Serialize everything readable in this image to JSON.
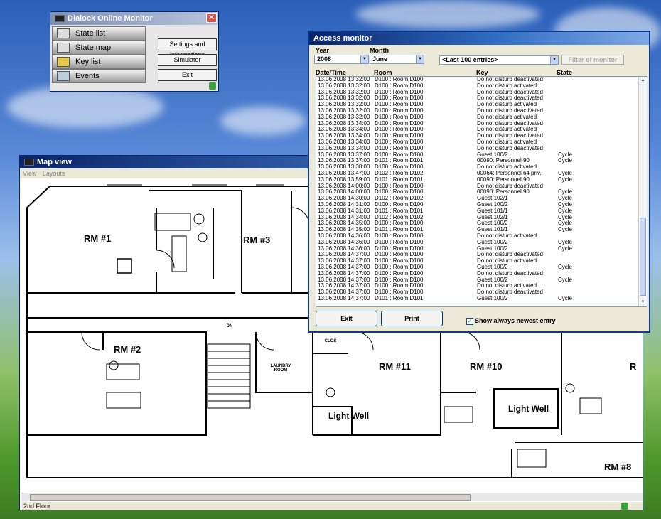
{
  "dialock": {
    "title": "Dialock Online Monitor",
    "nav": [
      {
        "label": "State list",
        "icon": "state-list-icon"
      },
      {
        "label": "State map",
        "icon": "state-map-icon"
      },
      {
        "label": "Key list",
        "icon": "key-list-icon"
      },
      {
        "label": "Events",
        "icon": "events-icon"
      }
    ],
    "buttons": {
      "settings": "Settings and informations",
      "simulator": "Simulator",
      "exit": "Exit"
    },
    "close": "✕"
  },
  "mapview": {
    "title": "Map view",
    "menu": [
      "View",
      "Layouts"
    ],
    "status": "2nd Floor",
    "rooms": [
      "RM #1",
      "RM #3",
      "RM #2",
      "RM #11",
      "RM #10",
      "R",
      "RM #8"
    ],
    "labels": {
      "laundry": "LAUNDRY ROOM",
      "clos": "CLOS",
      "light_well_1": "Light Well",
      "light_well_2": "Light Well",
      "dn": "DN"
    }
  },
  "access": {
    "title": "Access monitor",
    "year_label": "Year",
    "month_label": "Month",
    "year": "2008",
    "month": "June",
    "entries_filter": "<Last 100 entries>",
    "filter_button": "Filter of monitor",
    "columns": [
      "Date/Time",
      "Room",
      "Key",
      "State"
    ],
    "rows": [
      [
        "13.06.2008 13:32:00",
        "D100 : Room D100",
        "Do not disturb deactivated",
        ""
      ],
      [
        "13.06.2008 13:32:00",
        "D100 : Room D100",
        "Do not disturb activated",
        ""
      ],
      [
        "13.06.2008 13:32:00",
        "D100 : Room D100",
        "Do not disturb deactivated",
        ""
      ],
      [
        "13.06.2008 13:32:00",
        "D100 : Room D100",
        "Do not disturb deactivated",
        ""
      ],
      [
        "13.06.2008 13:32:00",
        "D100 : Room D100",
        "Do not disturb activated",
        ""
      ],
      [
        "13.06.2008 13:32:00",
        "D100 : Room D100",
        "Do not disturb deactivated",
        ""
      ],
      [
        "13.06.2008 13:32:00",
        "D100 : Room D100",
        "Do not disturb activated",
        ""
      ],
      [
        "13.06.2008 13:34:00",
        "D100 : Room D100",
        "Do not disturb deactivated",
        ""
      ],
      [
        "13.06.2008 13:34:00",
        "D100 : Room D100",
        "Do not disturb activated",
        ""
      ],
      [
        "13.06.2008 13:34:00",
        "D100 : Room D100",
        "Do not disturb deactivated",
        ""
      ],
      [
        "13.06.2008 13:34:00",
        "D100 : Room D100",
        "Do not disturb activated",
        ""
      ],
      [
        "13.06.2008 13:34:00",
        "D100 : Room D100",
        "Do not disturb deactivated",
        ""
      ],
      [
        "13.06.2008 13:37:00",
        "D100 : Room D100",
        "Guest 100/2",
        "Cycle"
      ],
      [
        "13.06.2008 13:37:00",
        "D101 : Room D101",
        "00090: Personnel 90",
        "Cycle"
      ],
      [
        "13.06.2008 13:38:00",
        "D100 : Room D100",
        "Do not disturb activated",
        ""
      ],
      [
        "13.06.2008 13:47:00",
        "D102 : Room D102",
        "00064: Personnel 64 priv.",
        "Cycle"
      ],
      [
        "13.06.2008 13:59:00",
        "D101 : Room D101",
        "00090: Personnel 90",
        "Cycle"
      ],
      [
        "13.06.2008 14:00:00",
        "D100 : Room D100",
        "Do not disturb deactivated",
        ""
      ],
      [
        "13.06.2008 14:00:00",
        "D100 : Room D100",
        "00090: Personnel 90",
        "Cycle"
      ],
      [
        "13.06.2008 14:30:00",
        "D102 : Room D102",
        "Guest 102/1",
        "Cycle"
      ],
      [
        "13.06.2008 14:31:00",
        "D100 : Room D100",
        "Guest 100/2",
        "Cycle"
      ],
      [
        "13.06.2008 14:31:00",
        "D101 : Room D101",
        "Guest 101/1",
        "Cycle"
      ],
      [
        "13.06.2008 14:34:00",
        "D102 : Room D102",
        "Guest 102/1",
        "Cycle"
      ],
      [
        "13.06.2008 14:35:00",
        "D100 : Room D100",
        "Guest 100/2",
        "Cycle"
      ],
      [
        "13.06.2008 14:35:00",
        "D101 : Room D101",
        "Guest 101/1",
        "Cycle"
      ],
      [
        "13.06.2008 14:36:00",
        "D100 : Room D100",
        "Do not disturb activated",
        ""
      ],
      [
        "13.06.2008 14:36:00",
        "D100 : Room D100",
        "Guest 100/2",
        "Cycle"
      ],
      [
        "13.06.2008 14:36:00",
        "D100 : Room D100",
        "Guest 100/2",
        "Cycle"
      ],
      [
        "13.06.2008 14:37:00",
        "D100 : Room D100",
        "Do not disturb deactivated",
        ""
      ],
      [
        "13.06.2008 14:37:00",
        "D100 : Room D100",
        "Do not disturb activated",
        ""
      ],
      [
        "13.06.2008 14:37:00",
        "D100 : Room D100",
        "Guest 100/2",
        "Cycle"
      ],
      [
        "13.06.2008 14:37:00",
        "D100 : Room D100",
        "Do not disturb deactivated",
        ""
      ],
      [
        "13.06.2008 14:37:00",
        "D100 : Room D100",
        "Guest 100/2",
        "Cycle"
      ],
      [
        "13.06.2008 14:37:00",
        "D100 : Room D100",
        "Do not disturb activated",
        ""
      ],
      [
        "13.06.2008 14:37:00",
        "D100 : Room D100",
        "Do not disturb deactivated",
        ""
      ],
      [
        "13.06.2008 14:37:00",
        "D101 : Room D101",
        "Guest 100/2",
        "Cycle"
      ]
    ],
    "exit_button": "Exit",
    "print_button": "Print",
    "show_newest": "Show always newest entry",
    "show_newest_checked": true
  }
}
